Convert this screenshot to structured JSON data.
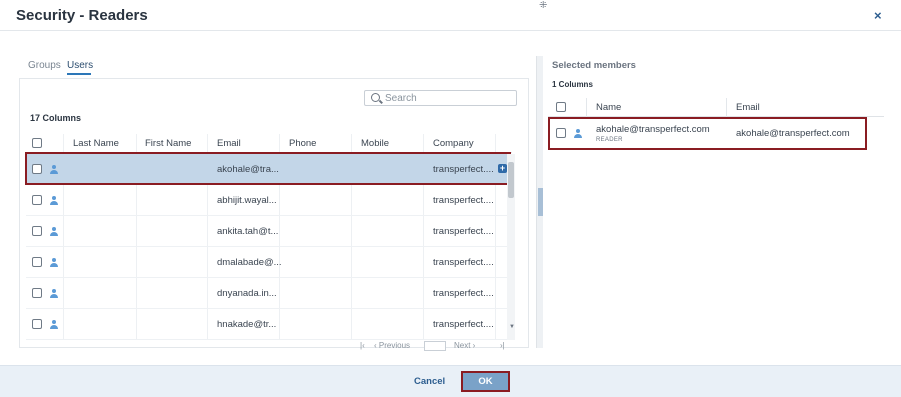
{
  "dialog": {
    "title": "Security - Readers",
    "close_glyph": "×",
    "drag_glyph": "⁜"
  },
  "tabs": [
    {
      "label": "Groups",
      "active": false
    },
    {
      "label": "Users",
      "active": true
    }
  ],
  "search": {
    "placeholder": "Search"
  },
  "left_grid": {
    "columns_count": "17 Columns",
    "headers": [
      "Last Name",
      "First Name",
      "Email",
      "Phone",
      "Mobile",
      "Company"
    ],
    "rows": [
      {
        "email": "akohale@tra...",
        "company": "transperfect....",
        "selected": true
      },
      {
        "email": "abhijit.wayal...",
        "company": "transperfect...."
      },
      {
        "email": "ankita.tah@t...",
        "company": "transperfect...."
      },
      {
        "email": "dmalabade@...",
        "company": "transperfect...."
      },
      {
        "email": "dnyanada.in...",
        "company": "transperfect...."
      },
      {
        "email": "hnakade@tr...",
        "company": "transperfect...."
      }
    ],
    "add_glyph": "+",
    "scroll_down_glyph": "▼"
  },
  "pager": {
    "first": "|‹",
    "prev": "‹ Previous",
    "next": "Next ›",
    "last": "›|"
  },
  "selected_members": {
    "title": "Selected members",
    "columns_count": "1 Columns",
    "headers": [
      "Name",
      "Email"
    ],
    "rows": [
      {
        "name": "akohale@transperfect.com",
        "role": "READER",
        "email": "akohale@transperfect.com"
      }
    ]
  },
  "footer": {
    "cancel_label": "Cancel",
    "ok_label": "OK"
  },
  "colors": {
    "accent": "#2c5d8f",
    "selected_row": "#c3d6e8",
    "highlight_border": "#8a1c22",
    "ok_button": "#7aa2c8",
    "footer_bg": "#e9f0f7"
  }
}
